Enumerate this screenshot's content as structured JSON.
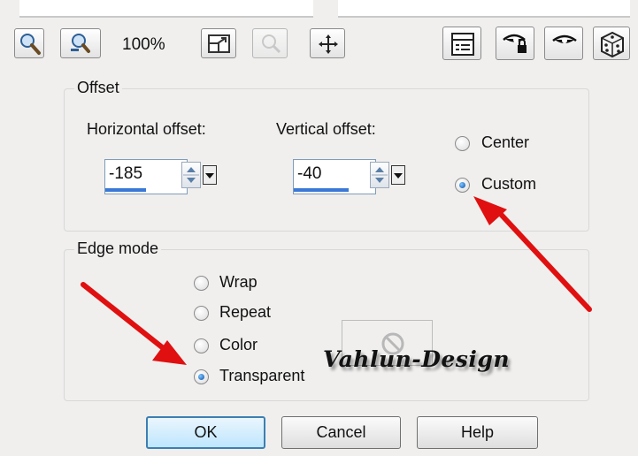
{
  "toolbar": {
    "zoom_level": "100%",
    "icons": [
      "zoom-in-icon",
      "zoom-out-icon",
      "zoom-to-fit-icon",
      "zoom-disabled-icon",
      "pan-move-icon",
      "preview-settings-icon",
      "eye-lock-icon",
      "eye-icon",
      "dice-randomize-icon"
    ]
  },
  "offset": {
    "legend": "Offset",
    "horizontal_label": "Horizontal offset:",
    "horizontal_value": "-185",
    "vertical_label": "Vertical offset:",
    "vertical_value": "-40",
    "center_label": "Center",
    "custom_label": "Custom",
    "selected": "Custom"
  },
  "edge_mode": {
    "legend": "Edge mode",
    "options": [
      "Wrap",
      "Repeat",
      "Color",
      "Transparent"
    ],
    "selected": "Transparent"
  },
  "buttons": {
    "ok": "OK",
    "cancel": "Cancel",
    "help": "Help"
  },
  "watermark": "Vahlun-Design",
  "annotation_color": "#e01010",
  "accent_color": "#3b78d6"
}
